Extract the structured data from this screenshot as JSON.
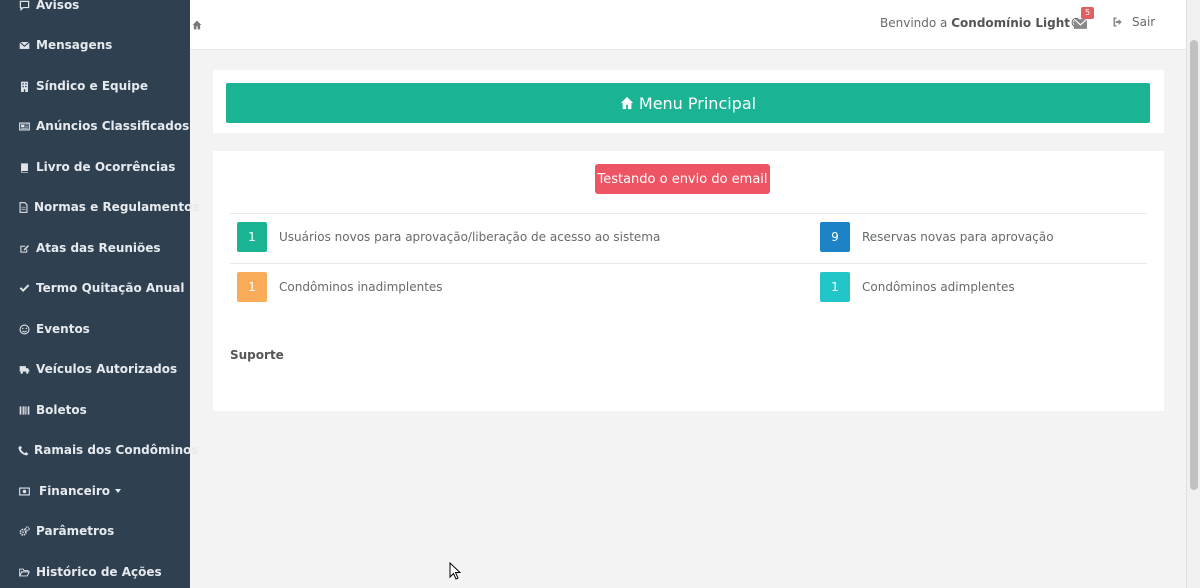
{
  "sidebar": {
    "items": [
      {
        "label": "Avisos",
        "icon": "comment-icon"
      },
      {
        "label": "Mensagens",
        "icon": "envelope-icon"
      },
      {
        "label": "Síndico e Equipe",
        "icon": "building-icon"
      },
      {
        "label": "Anúncios Classificados",
        "icon": "newspaper-icon"
      },
      {
        "label": "Livro de Ocorrências",
        "icon": "book-icon"
      },
      {
        "label": "Normas e Regulamentos",
        "icon": "document-icon"
      },
      {
        "label": "Atas das Reuniões",
        "icon": "edit-icon"
      },
      {
        "label": "Termo Quitação Anual",
        "icon": "check-icon"
      },
      {
        "label": "Eventos",
        "icon": "smile-icon"
      },
      {
        "label": "Veículos Autorizados",
        "icon": "truck-icon"
      },
      {
        "label": "Boletos",
        "icon": "barcode-icon"
      },
      {
        "label": "Ramais dos Condôminos",
        "icon": "phone-icon"
      },
      {
        "label": "Financeiro",
        "icon": "money-icon"
      },
      {
        "label": "Parâmetros",
        "icon": "gears-icon"
      },
      {
        "label": "Histórico de Ações",
        "icon": "folder-open-icon"
      }
    ]
  },
  "header": {
    "welcome_prefix": "Benvindo a",
    "welcome_name": "Condomínio Light©",
    "mail_count": "5",
    "logout_label": "Sair"
  },
  "main": {
    "menu_title": "Menu Principal",
    "email_button": "Testando o envio do email",
    "stats": [
      {
        "value": "1",
        "label": "Usuários novos para aprovação/liberação de acesso ao sistema",
        "color": "#1ab394"
      },
      {
        "value": "9",
        "label": "Reservas novas para aprovação",
        "color": "#1c84c6"
      },
      {
        "value": "1",
        "label": "Condôminos inadimplentes",
        "color": "#f8ac59"
      },
      {
        "value": "1",
        "label": "Condôminos adimplentes",
        "color": "#23c6c8"
      }
    ],
    "support_title": "Suporte"
  },
  "colors": {
    "sidebar_bg": "#2f4050",
    "primary": "#1ab394",
    "danger": "#ed5565",
    "info": "#1c84c6",
    "warning": "#f8ac59",
    "cyan": "#23c6c8"
  }
}
